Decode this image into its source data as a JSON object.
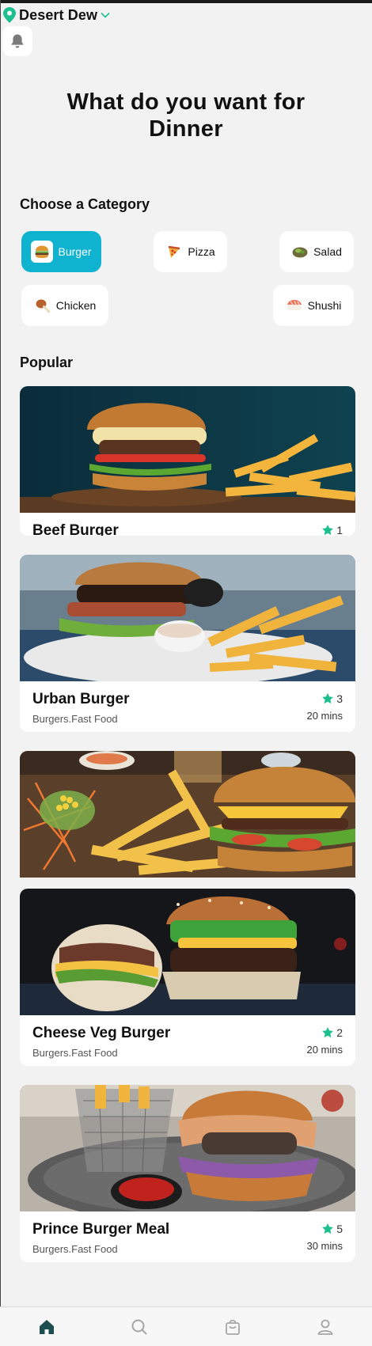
{
  "header": {
    "location": "Desert Dew",
    "accent_color": "#1dbf8f"
  },
  "hero": {
    "title_line1": "What do you want for",
    "title_line2": "Dinner"
  },
  "categories": {
    "heading": "Choose a Category",
    "items": [
      {
        "label": "Burger",
        "icon": "burger-icon",
        "active": true
      },
      {
        "label": "Pizza",
        "icon": "pizza-icon",
        "active": false
      },
      {
        "label": "Salad",
        "icon": "salad-icon",
        "active": false
      },
      {
        "label": "Chicken",
        "icon": "chicken-icon",
        "active": false
      },
      {
        "label": "Shushi",
        "icon": "sushi-icon",
        "active": false
      }
    ],
    "active_color": "#0fb3d0"
  },
  "popular": {
    "heading": "Popular",
    "items": [
      {
        "name": "Beef Burger",
        "rating": "1"
      },
      {
        "name": "Urban Burger",
        "subtitle": "Burgers.Fast Food",
        "rating": "3",
        "time": "20 mins"
      },
      {
        "name": "Cheese Veg Burger",
        "subtitle": "Burgers.Fast Food",
        "rating": "2",
        "time": "20 mins"
      },
      {
        "name": "Prince Burger Meal",
        "subtitle": "Burgers.Fast Food",
        "rating": "5",
        "time": "30 mins"
      }
    ],
    "star_color": "#1dbf8f"
  },
  "nav": {
    "items": [
      "home-icon",
      "search-icon",
      "bag-icon",
      "profile-icon"
    ],
    "active": "home-icon"
  }
}
